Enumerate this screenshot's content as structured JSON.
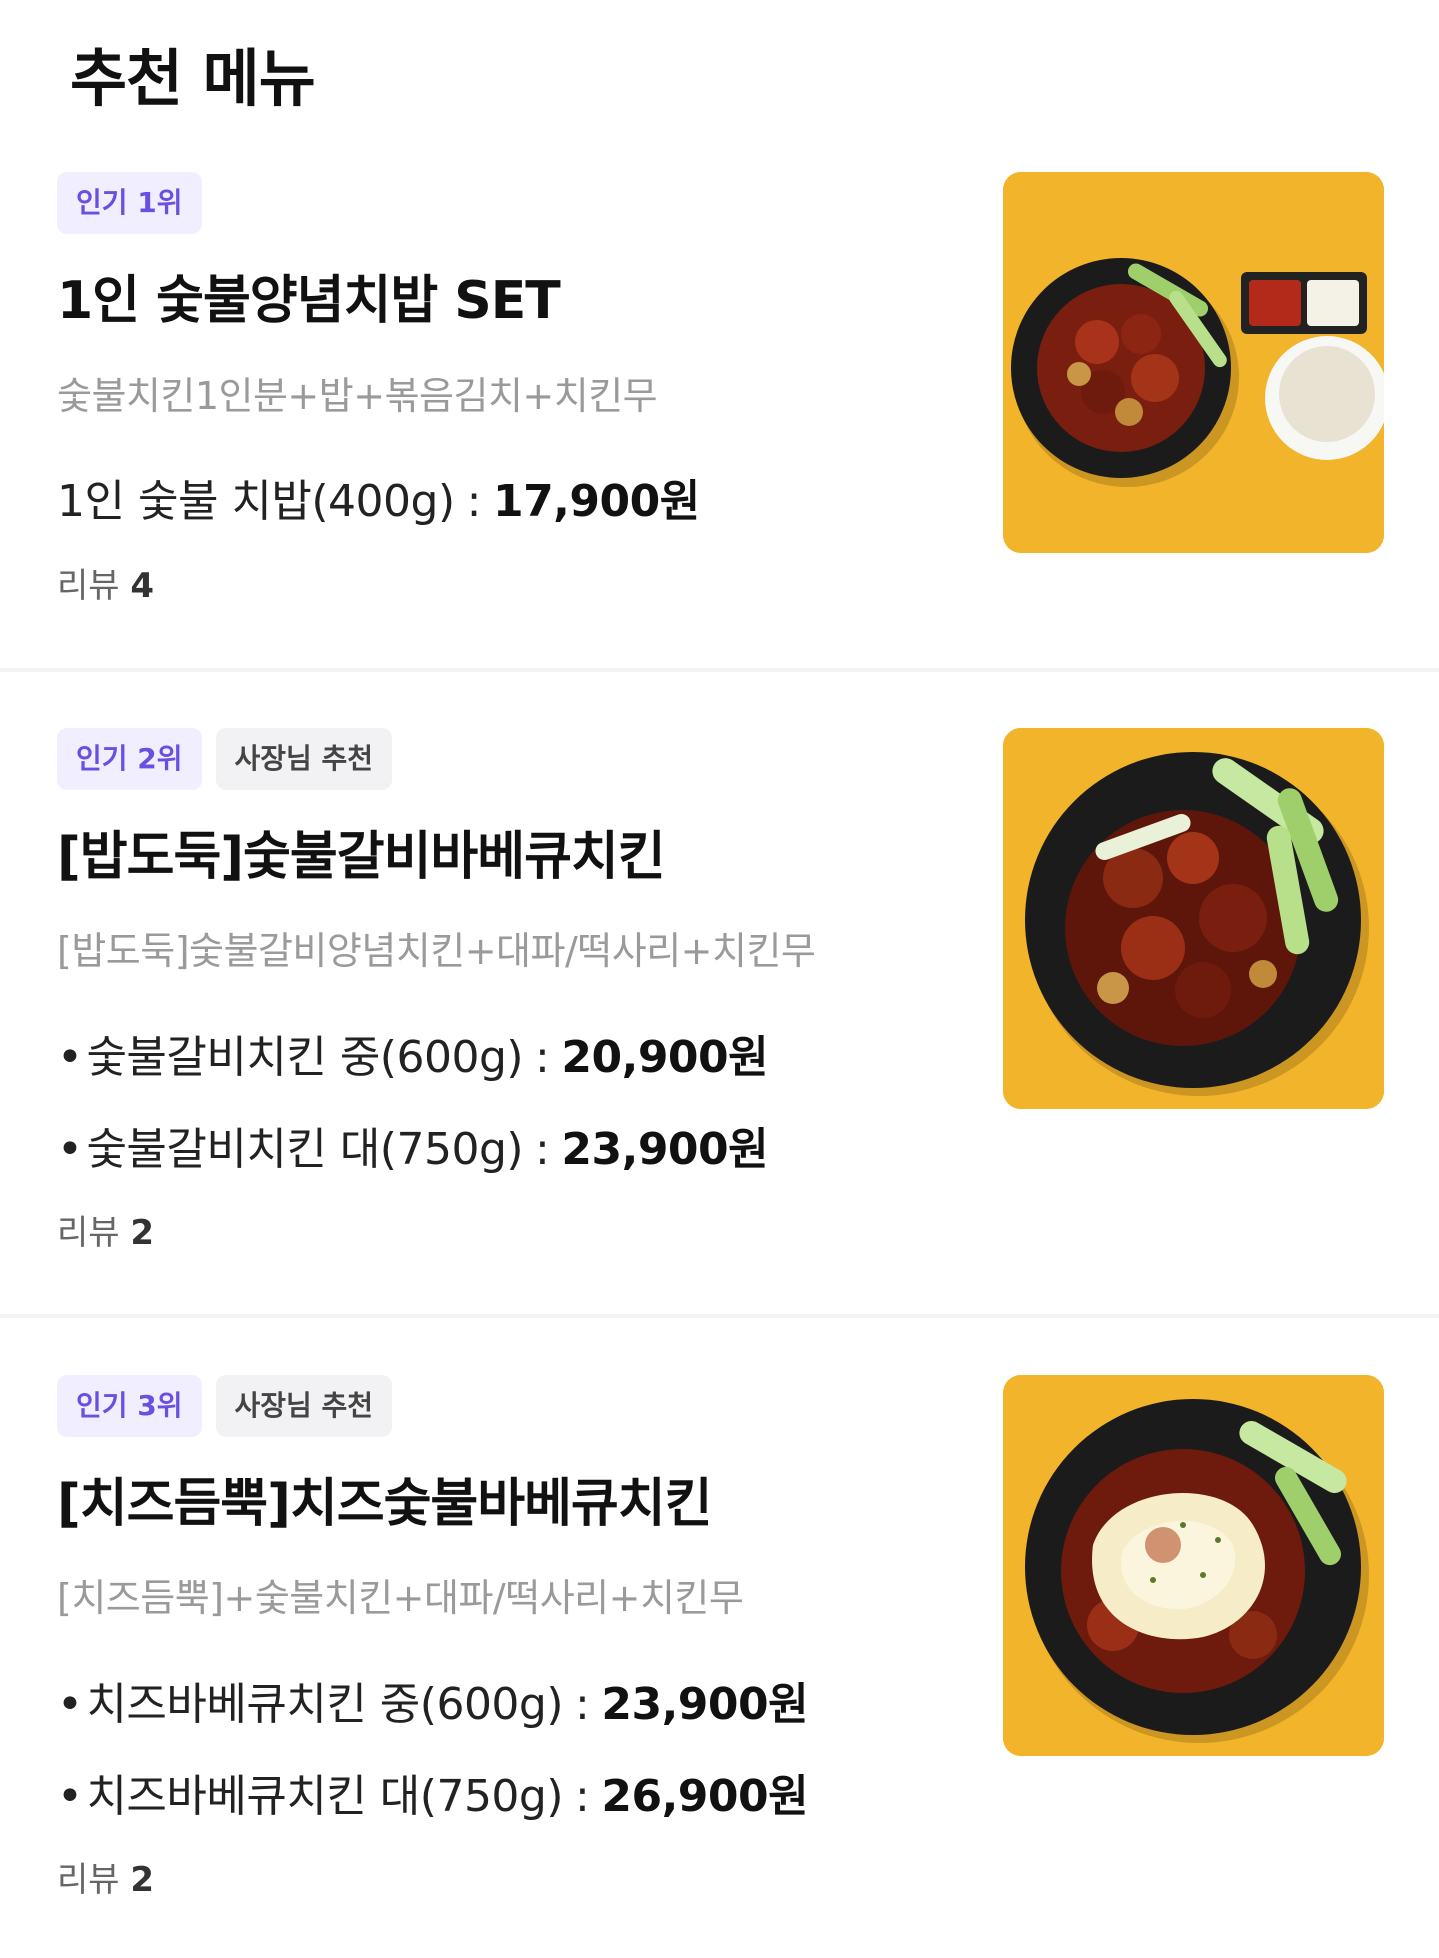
{
  "header": {
    "title": "추천 메뉴"
  },
  "items": [
    {
      "badges": {
        "popular": "인기 1위"
      },
      "name": "1인 숯불양념치밥 SET",
      "desc": "숯불치킨1인분+밥+볶음김치+치킨무",
      "prices": [
        {
          "label": "1인 숯불 치밥(400g)",
          "sep": ":",
          "price": "17,900원"
        }
      ],
      "review": {
        "label": "리뷰",
        "count": "4"
      },
      "photo": "chicken-rice-set-photo"
    },
    {
      "badges": {
        "popular": "인기 2위",
        "owner": "사장님 추천"
      },
      "name": "[밥도둑]숯불갈비바베큐치킨",
      "desc": "[밥도둑]숯불갈비양념치킨+대파/떡사리+치킨무",
      "prices": [
        {
          "bullet": "•",
          "label": "숯불갈비치킨 중(600g)",
          "sep": ":",
          "price": "20,900원"
        },
        {
          "bullet": "•",
          "label": "숯불갈비치킨 대(750g)",
          "sep": ":",
          "price": "23,900원"
        }
      ],
      "review": {
        "label": "리뷰",
        "count": "2"
      },
      "photo": "galbi-bbq-chicken-photo"
    },
    {
      "badges": {
        "popular": "인기 3위",
        "owner": "사장님 추천"
      },
      "name": "[치즈듬뿍]치즈숯불바베큐치킨",
      "desc": "[치즈듬뿍]+숯불치킨+대파/떡사리+치킨무",
      "prices": [
        {
          "bullet": "•",
          "label": "치즈바베큐치킨 중(600g)",
          "sep": ":",
          "price": "23,900원"
        },
        {
          "bullet": "•",
          "label": "치즈바베큐치킨 대(750g)",
          "sep": ":",
          "price": "26,900원"
        }
      ],
      "review": {
        "label": "리뷰",
        "count": "2"
      },
      "photo": "cheese-bbq-chicken-photo"
    }
  ],
  "colors": {
    "popular_badge_text": "#6a4fe0",
    "popular_badge_bg": "#f1efff",
    "photo_background": "#f2b42a"
  }
}
